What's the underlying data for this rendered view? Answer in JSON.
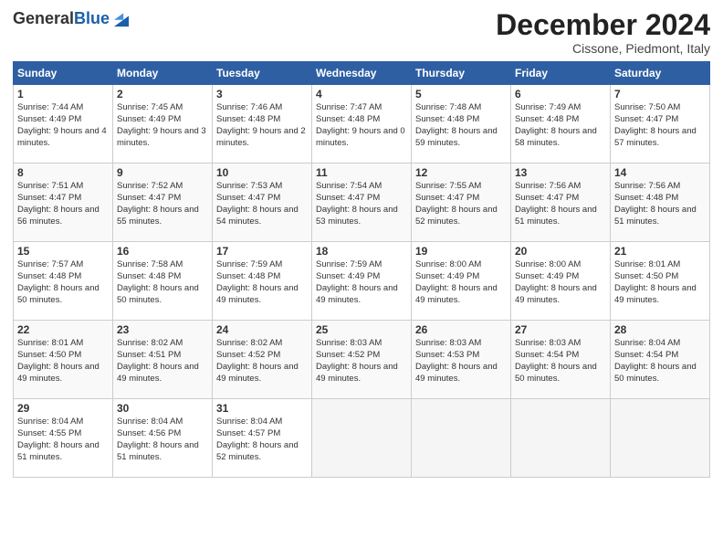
{
  "logo": {
    "general": "General",
    "blue": "Blue"
  },
  "header": {
    "month": "December 2024",
    "location": "Cissone, Piedmont, Italy"
  },
  "days_of_week": [
    "Sunday",
    "Monday",
    "Tuesday",
    "Wednesday",
    "Thursday",
    "Friday",
    "Saturday"
  ],
  "weeks": [
    [
      {
        "day": "1",
        "rise": "7:44 AM",
        "set": "4:49 PM",
        "daylight": "9 hours and 4 minutes."
      },
      {
        "day": "2",
        "rise": "7:45 AM",
        "set": "4:49 PM",
        "daylight": "9 hours and 3 minutes."
      },
      {
        "day": "3",
        "rise": "7:46 AM",
        "set": "4:48 PM",
        "daylight": "9 hours and 2 minutes."
      },
      {
        "day": "4",
        "rise": "7:47 AM",
        "set": "4:48 PM",
        "daylight": "9 hours and 0 minutes."
      },
      {
        "day": "5",
        "rise": "7:48 AM",
        "set": "4:48 PM",
        "daylight": "8 hours and 59 minutes."
      },
      {
        "day": "6",
        "rise": "7:49 AM",
        "set": "4:48 PM",
        "daylight": "8 hours and 58 minutes."
      },
      {
        "day": "7",
        "rise": "7:50 AM",
        "set": "4:47 PM",
        "daylight": "8 hours and 57 minutes."
      }
    ],
    [
      {
        "day": "8",
        "rise": "7:51 AM",
        "set": "4:47 PM",
        "daylight": "8 hours and 56 minutes."
      },
      {
        "day": "9",
        "rise": "7:52 AM",
        "set": "4:47 PM",
        "daylight": "8 hours and 55 minutes."
      },
      {
        "day": "10",
        "rise": "7:53 AM",
        "set": "4:47 PM",
        "daylight": "8 hours and 54 minutes."
      },
      {
        "day": "11",
        "rise": "7:54 AM",
        "set": "4:47 PM",
        "daylight": "8 hours and 53 minutes."
      },
      {
        "day": "12",
        "rise": "7:55 AM",
        "set": "4:47 PM",
        "daylight": "8 hours and 52 minutes."
      },
      {
        "day": "13",
        "rise": "7:56 AM",
        "set": "4:47 PM",
        "daylight": "8 hours and 51 minutes."
      },
      {
        "day": "14",
        "rise": "7:56 AM",
        "set": "4:48 PM",
        "daylight": "8 hours and 51 minutes."
      }
    ],
    [
      {
        "day": "15",
        "rise": "7:57 AM",
        "set": "4:48 PM",
        "daylight": "8 hours and 50 minutes."
      },
      {
        "day": "16",
        "rise": "7:58 AM",
        "set": "4:48 PM",
        "daylight": "8 hours and 50 minutes."
      },
      {
        "day": "17",
        "rise": "7:59 AM",
        "set": "4:48 PM",
        "daylight": "8 hours and 49 minutes."
      },
      {
        "day": "18",
        "rise": "7:59 AM",
        "set": "4:49 PM",
        "daylight": "8 hours and 49 minutes."
      },
      {
        "day": "19",
        "rise": "8:00 AM",
        "set": "4:49 PM",
        "daylight": "8 hours and 49 minutes."
      },
      {
        "day": "20",
        "rise": "8:00 AM",
        "set": "4:49 PM",
        "daylight": "8 hours and 49 minutes."
      },
      {
        "day": "21",
        "rise": "8:01 AM",
        "set": "4:50 PM",
        "daylight": "8 hours and 49 minutes."
      }
    ],
    [
      {
        "day": "22",
        "rise": "8:01 AM",
        "set": "4:50 PM",
        "daylight": "8 hours and 49 minutes."
      },
      {
        "day": "23",
        "rise": "8:02 AM",
        "set": "4:51 PM",
        "daylight": "8 hours and 49 minutes."
      },
      {
        "day": "24",
        "rise": "8:02 AM",
        "set": "4:52 PM",
        "daylight": "8 hours and 49 minutes."
      },
      {
        "day": "25",
        "rise": "8:03 AM",
        "set": "4:52 PM",
        "daylight": "8 hours and 49 minutes."
      },
      {
        "day": "26",
        "rise": "8:03 AM",
        "set": "4:53 PM",
        "daylight": "8 hours and 49 minutes."
      },
      {
        "day": "27",
        "rise": "8:03 AM",
        "set": "4:54 PM",
        "daylight": "8 hours and 50 minutes."
      },
      {
        "day": "28",
        "rise": "8:04 AM",
        "set": "4:54 PM",
        "daylight": "8 hours and 50 minutes."
      }
    ],
    [
      {
        "day": "29",
        "rise": "8:04 AM",
        "set": "4:55 PM",
        "daylight": "8 hours and 51 minutes."
      },
      {
        "day": "30",
        "rise": "8:04 AM",
        "set": "4:56 PM",
        "daylight": "8 hours and 51 minutes."
      },
      {
        "day": "31",
        "rise": "8:04 AM",
        "set": "4:57 PM",
        "daylight": "8 hours and 52 minutes."
      },
      null,
      null,
      null,
      null
    ]
  ]
}
